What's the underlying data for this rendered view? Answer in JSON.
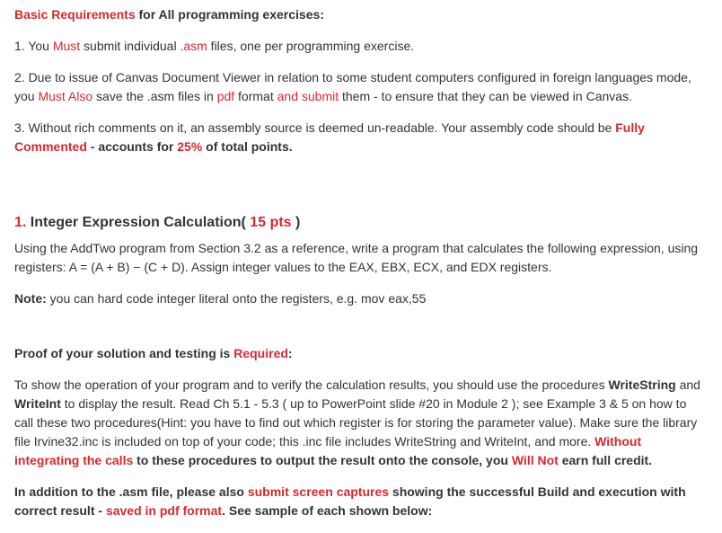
{
  "header": {
    "basic_req": "Basic Requirements",
    "for_all": " for All programming exercises:"
  },
  "req1": {
    "prefix": "1. You ",
    "must": "Must",
    "mid": " submit individual ",
    "asm": ".asm",
    "suffix": " files, one per programming exercise."
  },
  "req2": {
    "prefix": "2. Due to issue of Canvas Document Viewer in relation to some student computers configured in foreign languages mode, you ",
    "must_also": "Must Also",
    "mid1": " save the .asm files in ",
    "pdf": "pdf",
    "mid2": " format ",
    "and_submit": "and submit",
    "suffix": " them - to ensure that they can be viewed in Canvas."
  },
  "req3": {
    "prefix": "3. Without rich comments on it, an assembly source is deemed un-readable. Your assembly code should be ",
    "fully": "Fully Commented",
    "mid": " - accounts for ",
    "pct": "25%",
    "suffix": " of total points."
  },
  "ex1": {
    "num": "1.",
    "title": " Integer Expression Calculation( ",
    "pts": "15 pts",
    "close": " )"
  },
  "desc": "Using the AddTwo program from Section 3.2 as a reference, write a program that calculates the following expression, using registers: A = (A + B) − (C + D). Assign integer values to the EAX, EBX, ECX, and EDX registers.",
  "note": {
    "label": "Note:",
    "text": " you can hard code integer literal onto the registers, e.g. mov    eax,55"
  },
  "proof": {
    "prefix": "Proof of your solution and testing is ",
    "required": "Required",
    "colon": ":"
  },
  "body": {
    "p1a": "To show the operation of your program and to verify the calculation results, you should use the procedures ",
    "ws": "WriteString",
    "p1b": " and ",
    "wi": "WriteInt",
    "p1c": " to display the result. Read Ch 5.1 - 5.3 ( up to PowerPoint slide #20 in Module 2 ); see Example 3 & 5 on how to call these two procedures(Hint: you have to find out which register is for storing the parameter value). Make sure the library file Irvine32.inc is included on top of your code; this .inc file includes WriteString and WriteInt, and more. ",
    "without": "Without integrating the calls",
    "p1d": " to these procedures to output the result onto the console, you ",
    "willnot": "Will Not",
    "p1e": " earn full credit."
  },
  "footer": {
    "a": "In addition to the .asm file, please also ",
    "submit": "submit screen captures",
    "b": " showing the successful Build and execution with correct result - ",
    "saved": "saved in pdf format",
    "c": ". See sample of each shown below:"
  }
}
